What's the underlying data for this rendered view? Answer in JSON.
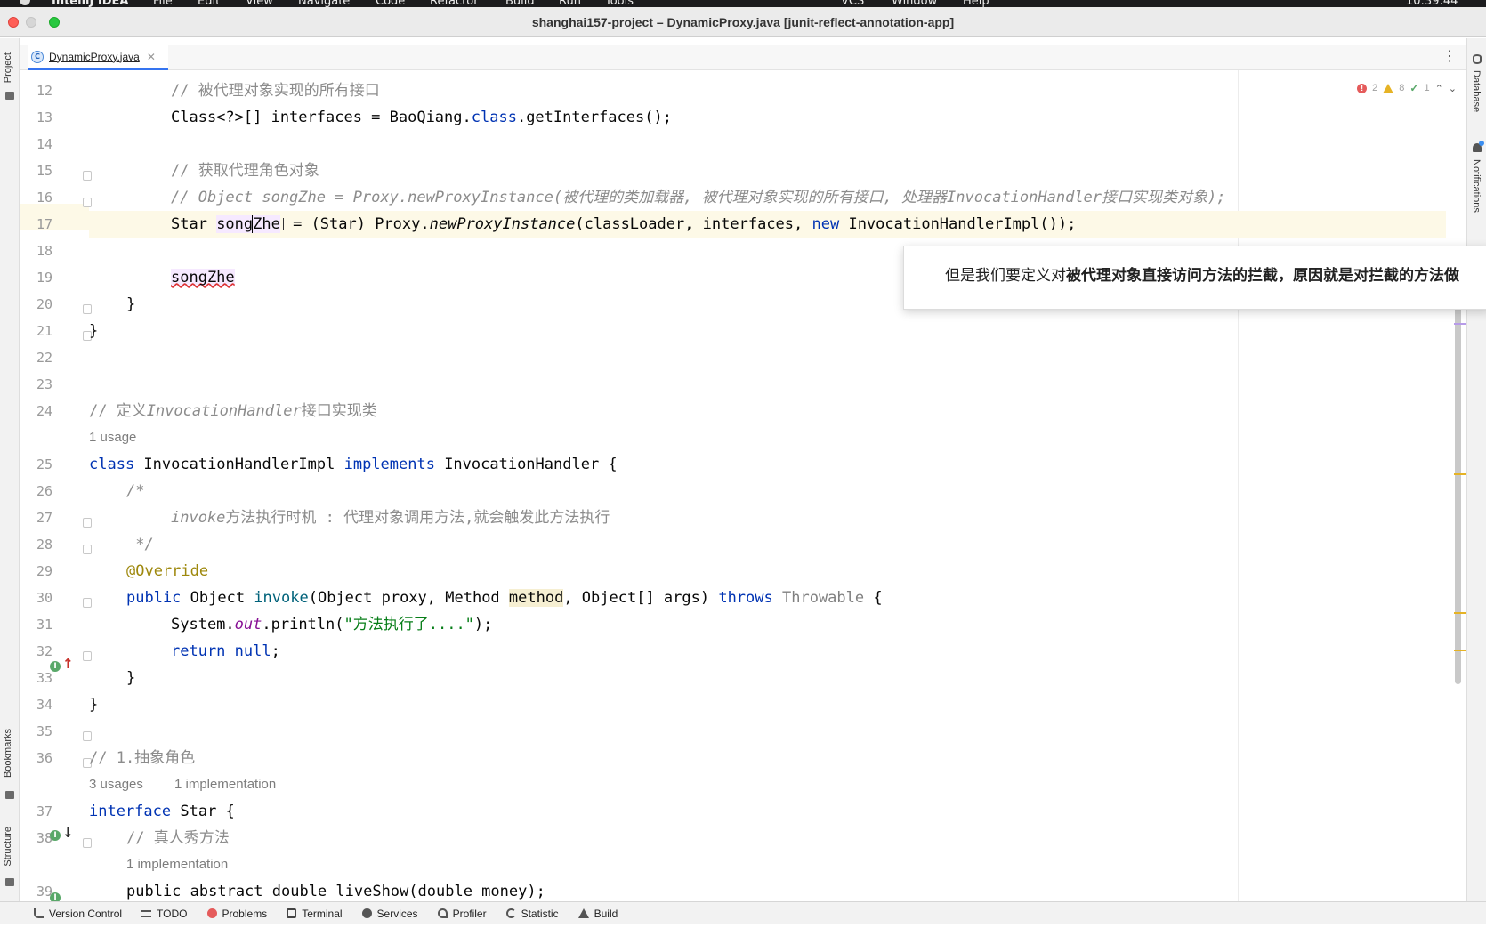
{
  "menubar": {
    "app_name": "IntelliJ IDEA",
    "items": [
      "File",
      "Edit",
      "View",
      "Navigate",
      "Code",
      "Refactor",
      "Build",
      "Run",
      "Tools"
    ],
    "right_items": [
      "VCS",
      "Window",
      "Help"
    ],
    "clock": "10:39:44"
  },
  "window": {
    "title": "shanghai157-project – DynamicProxy.java [junit-reflect-annotation-app]"
  },
  "tabs": [
    {
      "label": "DynamicProxy.java",
      "icon": "C",
      "active": true
    }
  ],
  "stripes": {
    "left_top": "Project",
    "left_bookmarks": "Bookmarks",
    "left_structure": "Structure",
    "right_database": "Database",
    "right_notifications": "Notifications"
  },
  "inspections": {
    "errors": "2",
    "warnings": "8",
    "ok": "1"
  },
  "hints": {
    "usage_1": "1 usage",
    "usages_3": "3 usages",
    "impl_1": "1 implementation",
    "impl_2": "1 implementation"
  },
  "code": {
    "l12_comment": "// 被代理对象实现的所有接口",
    "l13_a": "Class<?>[] interfaces = BaoQiang.",
    "l13_kw": "class",
    "l13_b": ".getInterfaces();",
    "l15_comment": "// 获取代理角色对象",
    "l16_comment": "// Object songZhe = Proxy.newProxyInstance(被代理的类加载器, 被代理对象实现的所有接口, 处理器InvocationHandler接口实现类对象);",
    "l17_a": "Star ",
    "l17_sel1": "song",
    "l17_sel2": "Zhe",
    "l17_b": " = (Star) Proxy.",
    "l17_it": "newProxyInstance",
    "l17_c": "(classLoader, interfaces, ",
    "l17_kw": "new",
    "l17_d": " InvocationHandlerImpl());",
    "l19": "songZhe",
    "l20": "}",
    "l21": "}",
    "l24_a": "// 定义",
    "l24_it": "InvocationHandler",
    "l24_b": "接口实现类",
    "l25_kw1": "class",
    "l25_a": " InvocationHandlerImpl ",
    "l25_kw2": "implements",
    "l25_b": " InvocationHandler {",
    "l26": "/*",
    "l27_it": "invoke",
    "l27_b": "方法执行时机 : 代理对象调用方法,就会触发此方法执行",
    "l28": " */",
    "l29": "@Override",
    "l30_kw": "public",
    "l30_a": " Object ",
    "l30_fn": "invoke",
    "l30_b": "(Object proxy, Method ",
    "l30_hl": "method",
    "l30_c": ", Object[] args) ",
    "l30_kw2": "throws",
    "l30_d": " ",
    "l30_gray": "Throwable",
    "l30_e": " {",
    "l31_a": "System.",
    "l31_st": "out",
    "l31_b": ".println(",
    "l31_str": "\"方法执行了....\"",
    "l31_c": ");",
    "l32_kw": "return null",
    "l32_b": ";",
    "l33": "}",
    "l34": "}",
    "l36": "// 1.抽象角色",
    "l37_kw": "interface",
    "l37_b": " Star {",
    "l38": "// 真人秀方法",
    "l39": "public abstract double liveShow(double money);"
  },
  "line_numbers": [
    "12",
    "13",
    "14",
    "15",
    "16",
    "17",
    "18",
    "19",
    "20",
    "21",
    "22",
    "23",
    "24",
    "25",
    "26",
    "27",
    "28",
    "29",
    "30",
    "31",
    "32",
    "33",
    "34",
    "35",
    "36",
    "37",
    "38",
    "39"
  ],
  "subtitle": {
    "plain": "但是我们要定义对",
    "bold": "被代理对象直接访问方法的拦截，原因就是对拦截的方法做"
  },
  "statusbar": {
    "version_control": "Version Control",
    "todo": "TODO",
    "problems": "Problems",
    "terminal": "Terminal",
    "services": "Services",
    "profiler": "Profiler",
    "statistic": "Statistic",
    "build": "Build"
  },
  "colors": {
    "keyword": "#0033b3",
    "comment": "#8c8c8c",
    "string": "#067d17",
    "annotation": "#9e880d",
    "current_line": "#fdf9e7",
    "accent": "#3574f0"
  }
}
